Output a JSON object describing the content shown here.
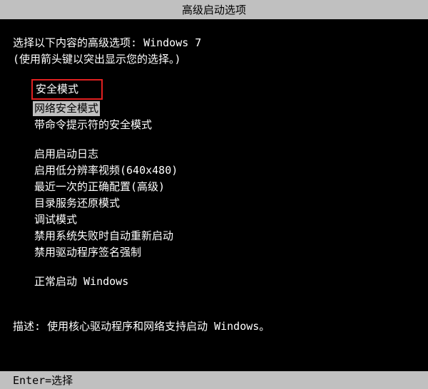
{
  "title": "高级启动选项",
  "prompt": "选择以下内容的高级选项: Windows 7",
  "hint": "(使用箭头键以突出显示您的选择。)",
  "options": {
    "group1": [
      {
        "label": "安全模式",
        "boxed": true,
        "highlighted": false
      },
      {
        "label": "网络安全模式",
        "boxed": false,
        "highlighted": true
      },
      {
        "label": "带命令提示符的安全模式",
        "boxed": false,
        "highlighted": false
      }
    ],
    "group2": [
      {
        "label": "启用启动日志"
      },
      {
        "label": "启用低分辨率视频(640x480)"
      },
      {
        "label": "最近一次的正确配置(高级)"
      },
      {
        "label": "目录服务还原模式"
      },
      {
        "label": "调试模式"
      },
      {
        "label": "禁用系统失败时自动重新启动"
      },
      {
        "label": "禁用驱动程序签名强制"
      }
    ],
    "group3": [
      {
        "label": "正常启动 Windows"
      }
    ]
  },
  "description_label": "描述: ",
  "description_text": "使用核心驱动程序和网络支持启动 Windows。",
  "footer": "Enter=选择"
}
